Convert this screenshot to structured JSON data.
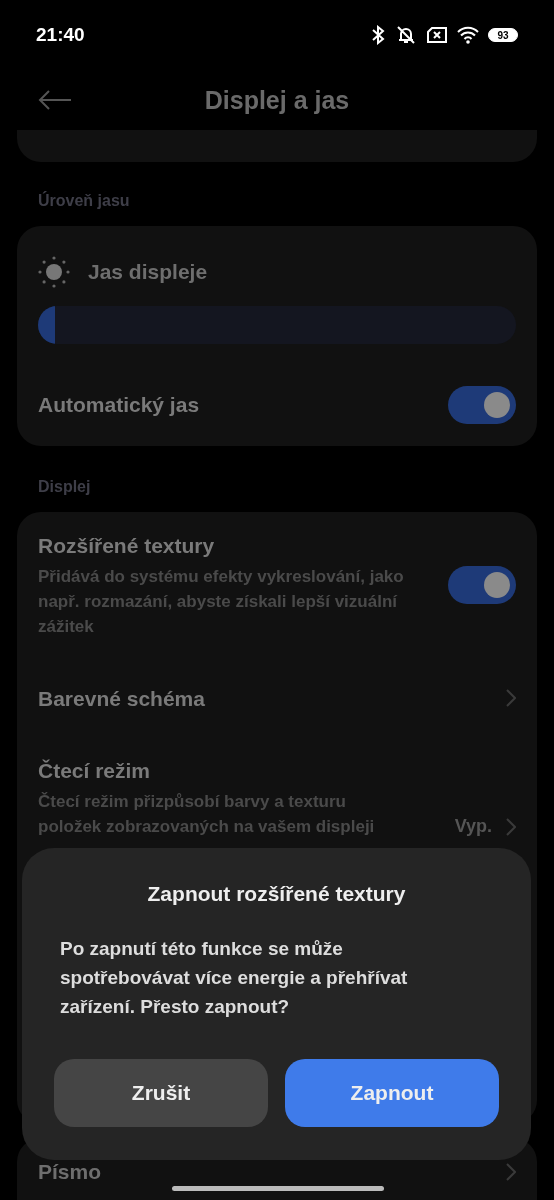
{
  "status_bar": {
    "time": "21:40",
    "battery": "93"
  },
  "header": {
    "title": "Displej a jas"
  },
  "brightness": {
    "title": "Úroveň jasu",
    "slider": {
      "label": "Jas displeje",
      "level": 0.035
    },
    "auto": {
      "label": "Automatický jas",
      "on": true
    }
  },
  "display": {
    "title": "Displej",
    "items": [
      {
        "kind": "toggle",
        "title": "Rozšířené textury",
        "description": "Přidává do systému efekty vykreslování, jako např. rozmazání, abyste získali lepší vizuální zážitek",
        "on": true
      },
      {
        "kind": "link",
        "title": "Barevné schéma"
      },
      {
        "kind": "link",
        "title": "Čtecí režim",
        "description": "Čtecí režim přizpůsobí barvy a texturu položek zobrazovaných na vašem displeji",
        "value": "Vyp."
      }
    ]
  },
  "font_item": {
    "title": "Písmo"
  },
  "dialog": {
    "title": "Zapnout rozšířené textury",
    "message": "Po zapnutí této funkce se může spotřebovávat více energie a přehřívat zařízení. Přesto zapnout?",
    "buttons": [
      {
        "label": "Zrušit",
        "kind": "secondary"
      },
      {
        "label": "Zapnout",
        "kind": "primary"
      }
    ]
  }
}
